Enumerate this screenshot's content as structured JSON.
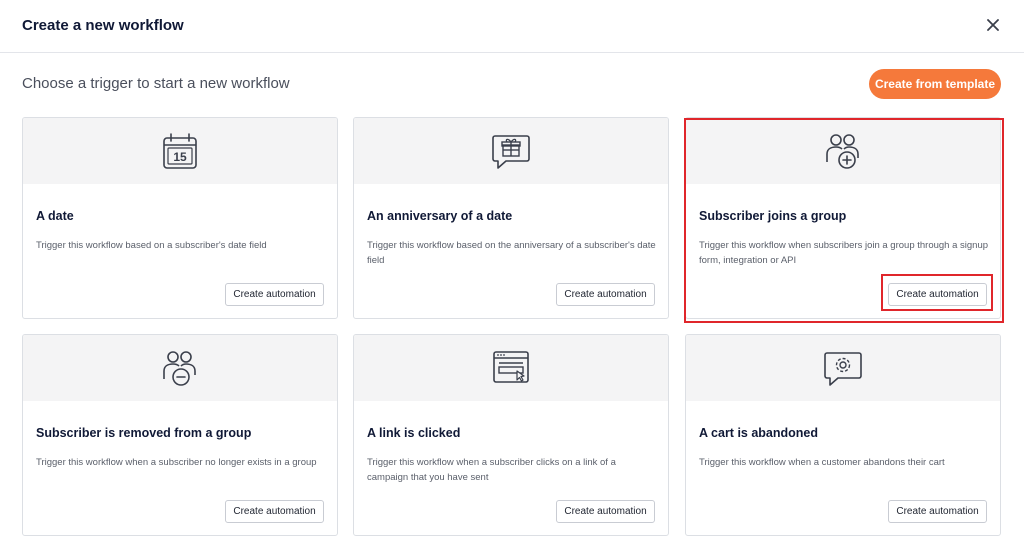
{
  "modal": {
    "title": "Create a new workflow",
    "subtitle": "Choose a trigger to start a new workflow",
    "template_button": "Create from template",
    "close_icon": "close-icon"
  },
  "colors": {
    "accent": "#f5793b",
    "highlight": "#e0262b",
    "title": "#101936"
  },
  "cards": [
    {
      "icon": "calendar-icon",
      "icon_text": "15",
      "title": "A date",
      "description": "Trigger this workflow based on a subscriber's date field",
      "button": "Create automation"
    },
    {
      "icon": "gift-message-icon",
      "title": "An anniversary of a date",
      "description": "Trigger this workflow based on the anniversary of a subscriber's date field",
      "button": "Create automation"
    },
    {
      "icon": "users-add-icon",
      "title": "Subscriber joins a group",
      "description": "Trigger this workflow when subscribers join a group through a signup form, integration or API",
      "button": "Create automation",
      "highlighted": true
    },
    {
      "icon": "users-remove-icon",
      "title": "Subscriber is removed from a group",
      "description": "Trigger this workflow when a subscriber no longer exists in a group",
      "button": "Create automation"
    },
    {
      "icon": "browser-click-icon",
      "title": "A link is clicked",
      "description": "Trigger this workflow when a subscriber clicks on a link of a campaign that you have sent",
      "button": "Create automation"
    },
    {
      "icon": "gear-message-icon",
      "title": "A cart is abandoned",
      "description": "Trigger this workflow when a customer abandons their cart",
      "button": "Create automation"
    }
  ]
}
